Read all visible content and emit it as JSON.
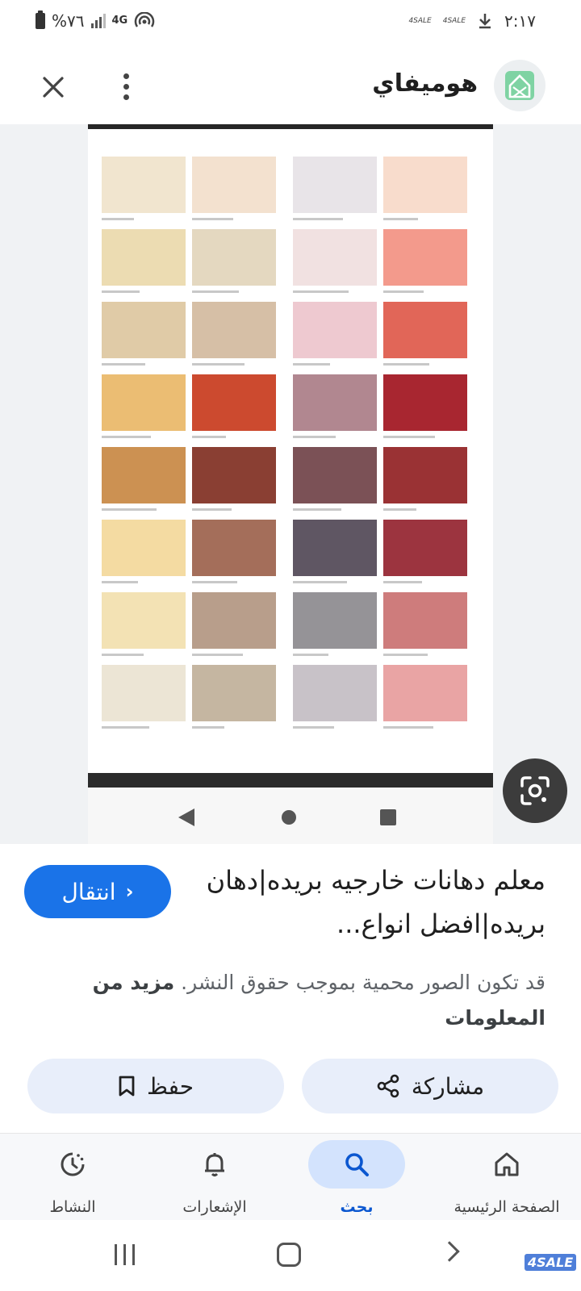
{
  "status_bar": {
    "time": "٢:١٧",
    "battery": "%٧٦",
    "network": "4G",
    "notif_tag": "4SALE"
  },
  "header": {
    "site_name": "هوميفاي",
    "logo_icon": "homify-house-icon"
  },
  "swatches": {
    "columns": [
      [
        "#f1e5cf",
        "#ecdcb2",
        "#e0cba7",
        "#ebbd73",
        "#cc9152",
        "#f4dba2",
        "#f3e2b4",
        "#ece5d5"
      ],
      [
        "#f3e1cf",
        "#e4d8c0",
        "#d6bfa6",
        "#cc4a2f",
        "#8a3f33",
        "#a46e5a",
        "#b89e8b",
        "#c5b6a1"
      ],
      [
        "#e8e4e8",
        "#f1e1e1",
        "#eec9d0",
        "#b18790",
        "#7b5156",
        "#5f5663",
        "#959397",
        "#c8c2c8"
      ],
      [
        "#f8dccc",
        "#f39a8c",
        "#e16658",
        "#a82630",
        "#9a3234",
        "#9c343f",
        "#ce7c7c",
        "#e9a4a4"
      ]
    ]
  },
  "result": {
    "title": "معلم دهانات خارجيه بريده|دهان بريده|افضل انواع...",
    "visit_label": "انتقال",
    "copyright_text": "قد تكون الصور محمية بموجب حقوق النشر.",
    "more_info": "مزيد من المعلومات"
  },
  "actions": {
    "share_label": "مشاركة",
    "save_label": "حفظ"
  },
  "bottom_nav": {
    "home": "الصفحة الرئيسية",
    "search": "بحث",
    "notifications": "الإشعارات",
    "activity": "النشاط",
    "active": "search"
  },
  "colors": {
    "accent": "#1a73e8",
    "chip": "#e8eefa",
    "nav_active_pill": "#d3e3fd"
  }
}
